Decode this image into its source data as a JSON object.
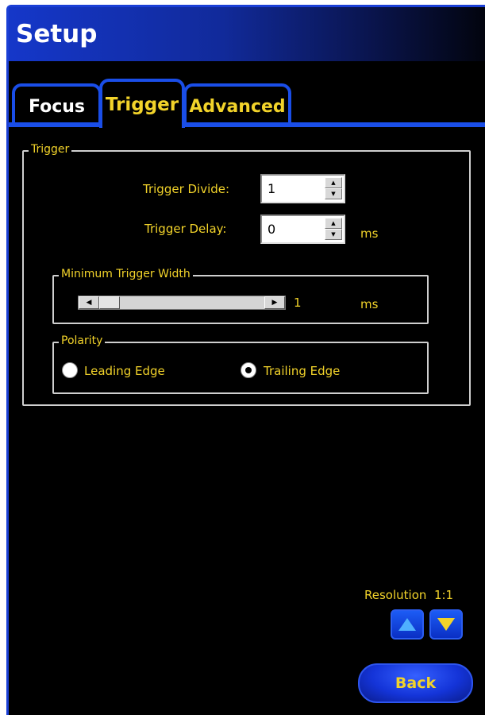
{
  "window": {
    "title": "Setup"
  },
  "tabs": [
    {
      "label": "Focus",
      "active": false
    },
    {
      "label": "Trigger",
      "active": true
    },
    {
      "label": "Advanced",
      "active": false
    }
  ],
  "trigger_group": {
    "legend": "Trigger",
    "trigger_divide": {
      "label": "Trigger Divide:",
      "value": "1"
    },
    "trigger_delay": {
      "label": "Trigger Delay:",
      "value": "0",
      "unit": "ms"
    },
    "min_width": {
      "legend": "Minimum Trigger Width",
      "value": "1",
      "unit": "ms",
      "slider_fraction": 0.0
    },
    "polarity": {
      "legend": "Polarity",
      "options": [
        {
          "label": "Leading Edge",
          "checked": false
        },
        {
          "label": "Trailing Edge",
          "checked": true
        }
      ]
    }
  },
  "resolution": {
    "label": "Resolution",
    "value": "1:1"
  },
  "back_label": "Back",
  "colors": {
    "accent_yellow": "#f2d32a",
    "tab_border_blue": "#1a4ee8",
    "title_blue": "#1537c9"
  },
  "icons": {
    "spin_up": "triangle-up",
    "spin_down": "triangle-down",
    "slider_left": "triangle-left",
    "slider_right": "triangle-right"
  }
}
